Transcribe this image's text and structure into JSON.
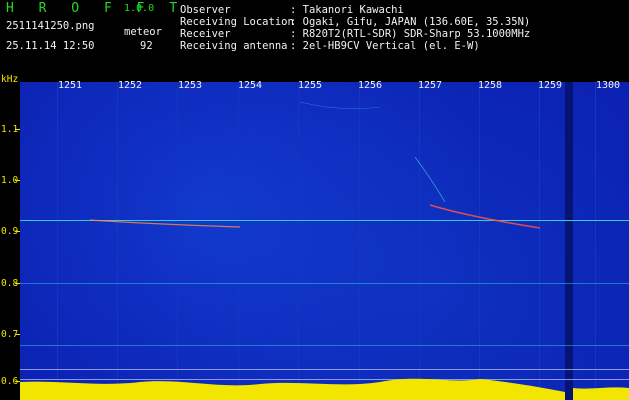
{
  "app": {
    "name_letters": "H R O F F T",
    "version": "1.0.0",
    "filename": "2511141250.png",
    "datetime": "25.11.14 12:50",
    "counter_label": "meteor",
    "counter_value": "92"
  },
  "info": {
    "rows": [
      {
        "label": "Observer",
        "value": ": Takanori Kawachi"
      },
      {
        "label": "Receiving Location",
        "value": ": Ogaki, Gifu, JAPAN (136.60E, 35.35N)"
      },
      {
        "label": "Receiver",
        "value": ": R820T2(RTL-SDR) SDR-Sharp 53.1000MHz"
      },
      {
        "label": "Receiving antenna",
        "value": ": 2el-HB9CV Vertical (el. E-W)"
      }
    ]
  },
  "axes": {
    "y_unit": "kHz",
    "y_ticks": [
      "1.1",
      "1.0",
      "0.9",
      "0.8",
      "0.7",
      "0.6"
    ],
    "x_ticks": [
      "1251",
      "1252",
      "1253",
      "1254",
      "1255",
      "1256",
      "1257",
      "1258",
      "1259",
      "1300"
    ]
  },
  "colors": {
    "background": "#000000",
    "brand_green": "#22d922",
    "label_yellow": "#f2e600",
    "plot_blue": "#0b1fb0",
    "trace_cyan": "#33ccdd"
  }
}
